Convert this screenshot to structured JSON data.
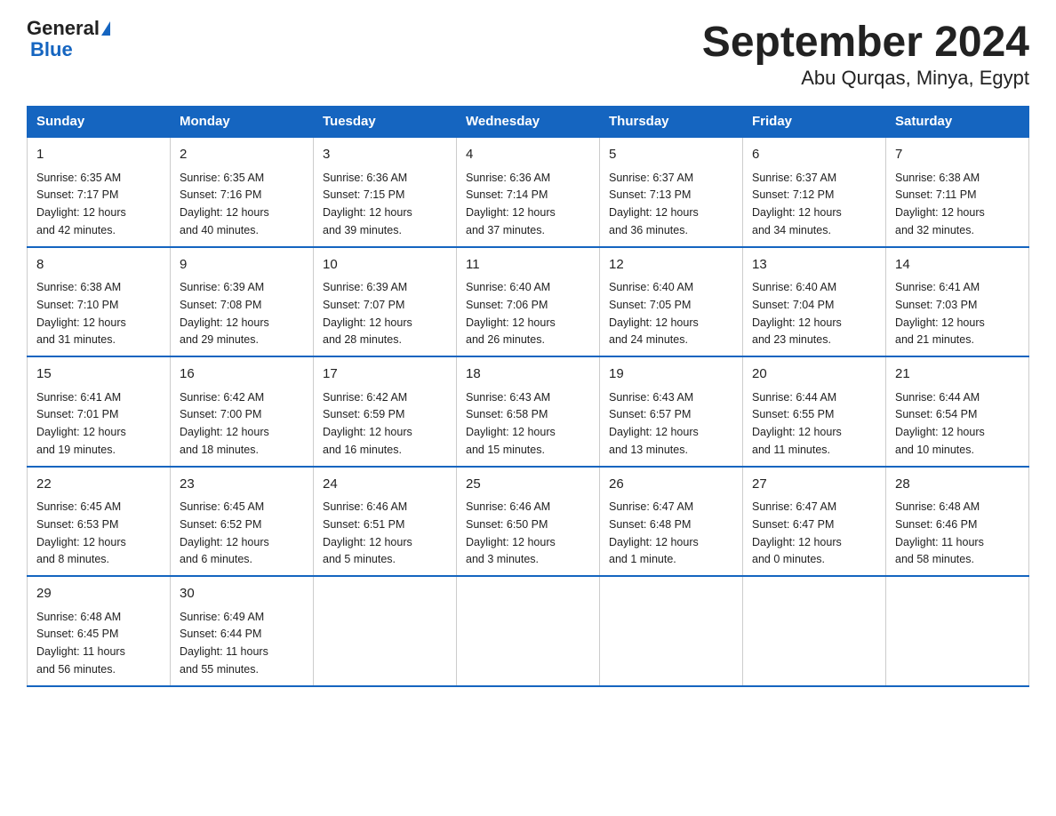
{
  "header": {
    "logo_line1": "General",
    "logo_line2": "Blue",
    "title": "September 2024",
    "subtitle": "Abu Qurqas, Minya, Egypt"
  },
  "days_of_week": [
    "Sunday",
    "Monday",
    "Tuesday",
    "Wednesday",
    "Thursday",
    "Friday",
    "Saturday"
  ],
  "weeks": [
    [
      {
        "day": "1",
        "sunrise": "6:35 AM",
        "sunset": "7:17 PM",
        "daylight": "12 hours and 42 minutes."
      },
      {
        "day": "2",
        "sunrise": "6:35 AM",
        "sunset": "7:16 PM",
        "daylight": "12 hours and 40 minutes."
      },
      {
        "day": "3",
        "sunrise": "6:36 AM",
        "sunset": "7:15 PM",
        "daylight": "12 hours and 39 minutes."
      },
      {
        "day": "4",
        "sunrise": "6:36 AM",
        "sunset": "7:14 PM",
        "daylight": "12 hours and 37 minutes."
      },
      {
        "day": "5",
        "sunrise": "6:37 AM",
        "sunset": "7:13 PM",
        "daylight": "12 hours and 36 minutes."
      },
      {
        "day": "6",
        "sunrise": "6:37 AM",
        "sunset": "7:12 PM",
        "daylight": "12 hours and 34 minutes."
      },
      {
        "day": "7",
        "sunrise": "6:38 AM",
        "sunset": "7:11 PM",
        "daylight": "12 hours and 32 minutes."
      }
    ],
    [
      {
        "day": "8",
        "sunrise": "6:38 AM",
        "sunset": "7:10 PM",
        "daylight": "12 hours and 31 minutes."
      },
      {
        "day": "9",
        "sunrise": "6:39 AM",
        "sunset": "7:08 PM",
        "daylight": "12 hours and 29 minutes."
      },
      {
        "day": "10",
        "sunrise": "6:39 AM",
        "sunset": "7:07 PM",
        "daylight": "12 hours and 28 minutes."
      },
      {
        "day": "11",
        "sunrise": "6:40 AM",
        "sunset": "7:06 PM",
        "daylight": "12 hours and 26 minutes."
      },
      {
        "day": "12",
        "sunrise": "6:40 AM",
        "sunset": "7:05 PM",
        "daylight": "12 hours and 24 minutes."
      },
      {
        "day": "13",
        "sunrise": "6:40 AM",
        "sunset": "7:04 PM",
        "daylight": "12 hours and 23 minutes."
      },
      {
        "day": "14",
        "sunrise": "6:41 AM",
        "sunset": "7:03 PM",
        "daylight": "12 hours and 21 minutes."
      }
    ],
    [
      {
        "day": "15",
        "sunrise": "6:41 AM",
        "sunset": "7:01 PM",
        "daylight": "12 hours and 19 minutes."
      },
      {
        "day": "16",
        "sunrise": "6:42 AM",
        "sunset": "7:00 PM",
        "daylight": "12 hours and 18 minutes."
      },
      {
        "day": "17",
        "sunrise": "6:42 AM",
        "sunset": "6:59 PM",
        "daylight": "12 hours and 16 minutes."
      },
      {
        "day": "18",
        "sunrise": "6:43 AM",
        "sunset": "6:58 PM",
        "daylight": "12 hours and 15 minutes."
      },
      {
        "day": "19",
        "sunrise": "6:43 AM",
        "sunset": "6:57 PM",
        "daylight": "12 hours and 13 minutes."
      },
      {
        "day": "20",
        "sunrise": "6:44 AM",
        "sunset": "6:55 PM",
        "daylight": "12 hours and 11 minutes."
      },
      {
        "day": "21",
        "sunrise": "6:44 AM",
        "sunset": "6:54 PM",
        "daylight": "12 hours and 10 minutes."
      }
    ],
    [
      {
        "day": "22",
        "sunrise": "6:45 AM",
        "sunset": "6:53 PM",
        "daylight": "12 hours and 8 minutes."
      },
      {
        "day": "23",
        "sunrise": "6:45 AM",
        "sunset": "6:52 PM",
        "daylight": "12 hours and 6 minutes."
      },
      {
        "day": "24",
        "sunrise": "6:46 AM",
        "sunset": "6:51 PM",
        "daylight": "12 hours and 5 minutes."
      },
      {
        "day": "25",
        "sunrise": "6:46 AM",
        "sunset": "6:50 PM",
        "daylight": "12 hours and 3 minutes."
      },
      {
        "day": "26",
        "sunrise": "6:47 AM",
        "sunset": "6:48 PM",
        "daylight": "12 hours and 1 minute."
      },
      {
        "day": "27",
        "sunrise": "6:47 AM",
        "sunset": "6:47 PM",
        "daylight": "12 hours and 0 minutes."
      },
      {
        "day": "28",
        "sunrise": "6:48 AM",
        "sunset": "6:46 PM",
        "daylight": "11 hours and 58 minutes."
      }
    ],
    [
      {
        "day": "29",
        "sunrise": "6:48 AM",
        "sunset": "6:45 PM",
        "daylight": "11 hours and 56 minutes."
      },
      {
        "day": "30",
        "sunrise": "6:49 AM",
        "sunset": "6:44 PM",
        "daylight": "11 hours and 55 minutes."
      },
      null,
      null,
      null,
      null,
      null
    ]
  ],
  "labels": {
    "sunrise": "Sunrise:",
    "sunset": "Sunset:",
    "daylight": "Daylight:"
  }
}
